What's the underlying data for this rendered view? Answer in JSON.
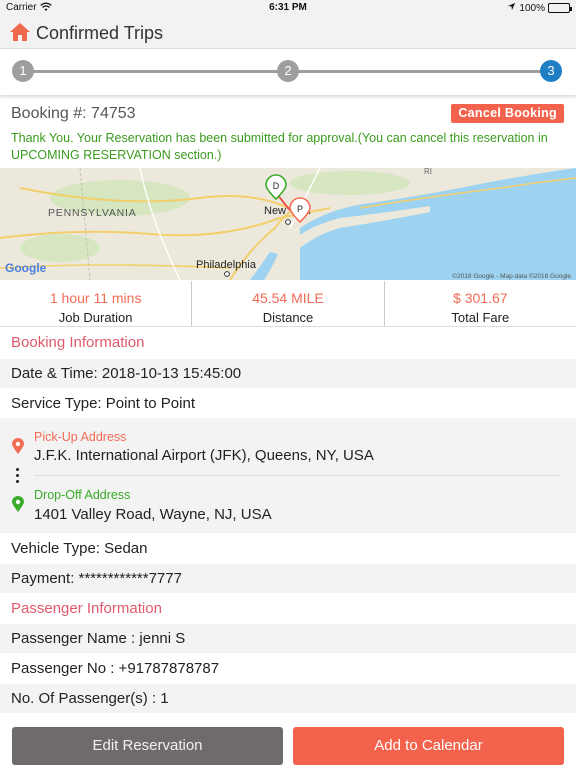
{
  "status_bar": {
    "carrier": "Carrier",
    "time": "6:31 PM",
    "battery": "100%",
    "battery_level_percent": 100,
    "icons": [
      "wifi-icon",
      "location-arrow-icon",
      "battery-icon"
    ]
  },
  "header": {
    "title": "Confirmed Trips",
    "icon": "home-icon"
  },
  "stepper": {
    "steps": [
      "1",
      "2",
      "3"
    ],
    "active_step": 3
  },
  "booking": {
    "number": "Booking #: 74753",
    "cancel_label": "Cancel Booking",
    "message": "Thank You. Your Reservation has been submitted for approval.(You can cancel this reservation in UPCOMING RESERVATION section.)"
  },
  "map": {
    "labels": {
      "state": "PENNSYLVANIA",
      "city_new_york": "New York",
      "city_philadelphia": "Philadelphia",
      "google": "Google",
      "attribution": "©2018 Google - Map data ©2018 Google",
      "ri": "RI",
      "marker_dropoff": "D",
      "marker_pickup": "P"
    }
  },
  "stats": [
    {
      "value": "1 hour 11 mins",
      "label": "Job Duration"
    },
    {
      "value": "45.54 MILE",
      "label": "Distance"
    },
    {
      "value": "$ 301.67",
      "label": "Total Fare"
    }
  ],
  "booking_info": {
    "title": "Booking Information",
    "date_time": "Date & Time: 2018-10-13 15:45:00",
    "service_type": "Service Type: Point to Point",
    "pickup_label": "Pick-Up Address",
    "pickup_value": "J.F.K. International Airport (JFK), Queens, NY, USA",
    "dropoff_label": "Drop-Off Address",
    "dropoff_value": "1401 Valley Road, Wayne, NJ, USA",
    "vehicle_type": "Vehicle Type: Sedan",
    "payment": "Payment: ************7777"
  },
  "passenger_info": {
    "title": "Passenger Information",
    "name": "Passenger Name :  jenni S",
    "number": "Passenger No :  +91787878787",
    "count": "No. Of Passenger(s) :  1"
  },
  "actions": {
    "edit_label": "Edit Reservation",
    "calendar_label": "Add to Calendar"
  },
  "colors": {
    "accent_red": "#f2624d",
    "section_pink": "#e0596c",
    "success_green": "#3a9b1e",
    "step_active": "#1f7fc4",
    "step_inactive": "#9e9e9e",
    "pickup_pin": "#f26b55",
    "dropoff_pin": "#3aab2a"
  }
}
